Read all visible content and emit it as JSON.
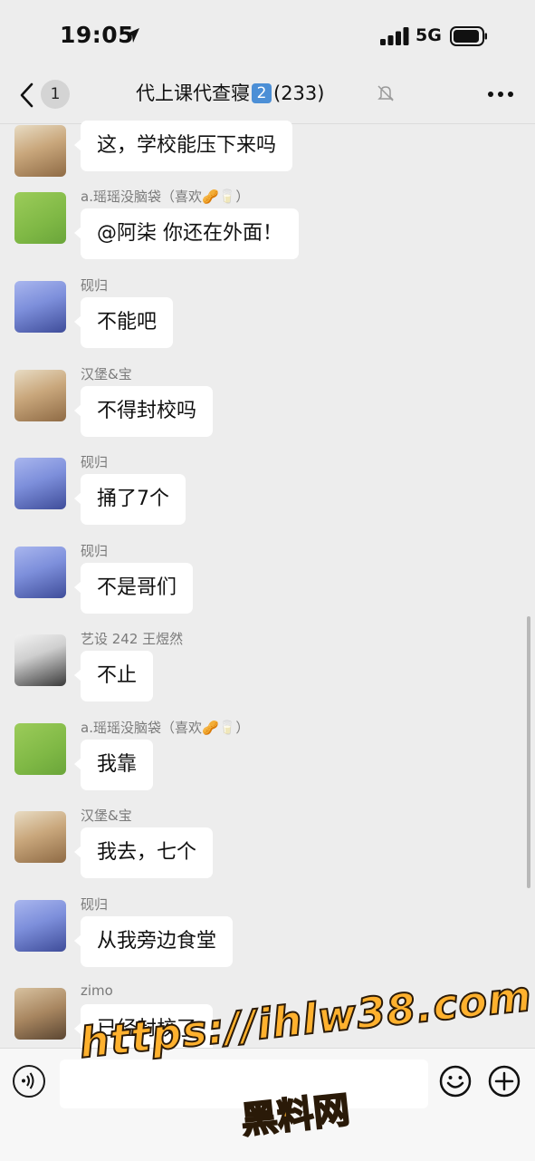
{
  "status_bar": {
    "time": "19:05",
    "network": "5G"
  },
  "nav": {
    "back_count": "1",
    "title_prefix": "代上课代查寝",
    "title_badge": "2",
    "title_count": "(233)"
  },
  "messages": [
    {
      "sender": "",
      "text": "这，学校能压下来吗",
      "avatar": "baby"
    },
    {
      "sender": "a.瑶瑶没脑袋（喜欢🥜🥛）",
      "text": "@阿柒 你还在外面！",
      "avatar": "green"
    },
    {
      "sender": "砚归",
      "text": "不能吧",
      "avatar": "anime"
    },
    {
      "sender": "汉堡&宝",
      "text": "不得封校吗",
      "avatar": "baby"
    },
    {
      "sender": "砚归",
      "text": "捅了7个",
      "avatar": "anime"
    },
    {
      "sender": "砚归",
      "text": "不是哥们",
      "avatar": "anime"
    },
    {
      "sender": "艺设 242 王煜然",
      "text": "不止",
      "avatar": "grey"
    },
    {
      "sender": "a.瑶瑶没脑袋（喜欢🥜🥛）",
      "text": "我靠",
      "avatar": "green"
    },
    {
      "sender": "汉堡&宝",
      "text": "我去，七个",
      "avatar": "baby"
    },
    {
      "sender": "砚归",
      "text": "从我旁边食堂",
      "avatar": "anime"
    },
    {
      "sender": "zimo",
      "text": "已经封校了",
      "avatar": "cat"
    }
  ],
  "watermark": {
    "line1": "https://ihlw38.com",
    "line2": "黑料网"
  },
  "icons": {
    "location": "location-arrow-icon",
    "signal": "signal-bars-icon",
    "battery": "battery-icon",
    "back": "chevron-left-icon",
    "mute": "bell-muted-icon",
    "more": "more-dots-icon",
    "voice": "voice-icon",
    "emoji": "emoji-icon",
    "plus": "plus-icon"
  }
}
